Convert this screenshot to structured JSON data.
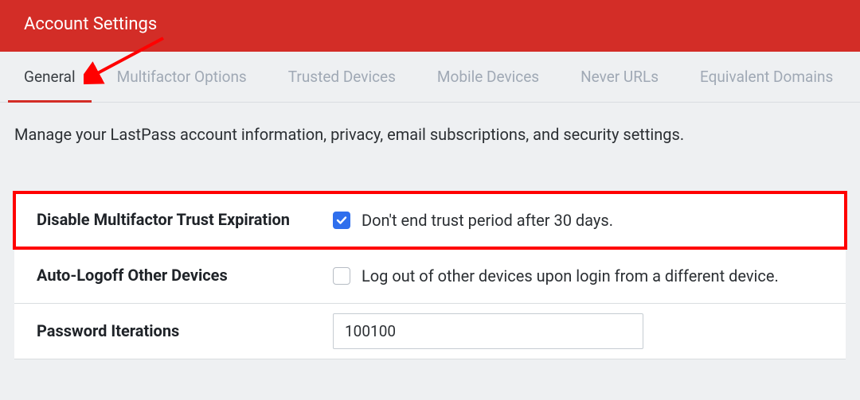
{
  "header": {
    "title": "Account Settings"
  },
  "tabs": [
    {
      "label": "General",
      "active": true
    },
    {
      "label": "Multifactor Options",
      "active": false
    },
    {
      "label": "Trusted Devices",
      "active": false
    },
    {
      "label": "Mobile Devices",
      "active": false
    },
    {
      "label": "Never URLs",
      "active": false
    },
    {
      "label": "Equivalent Domains",
      "active": false
    }
  ],
  "description": "Manage your LastPass account information, privacy, email subscriptions, and security settings.",
  "settings": {
    "disable_multifactor_trust": {
      "label": "Disable Multifactor Trust Expiration",
      "checkbox_text": "Don't end trust period after 30 days.",
      "checked": true
    },
    "auto_logoff": {
      "label": "Auto-Logoff Other Devices",
      "checkbox_text": "Log out of other devices upon login from a different device.",
      "checked": false
    },
    "password_iterations": {
      "label": "Password Iterations",
      "value": "100100"
    }
  },
  "colors": {
    "brand_red": "#d32d27",
    "checkbox_blue": "#2f6fed",
    "highlight_red": "#ff0000"
  }
}
